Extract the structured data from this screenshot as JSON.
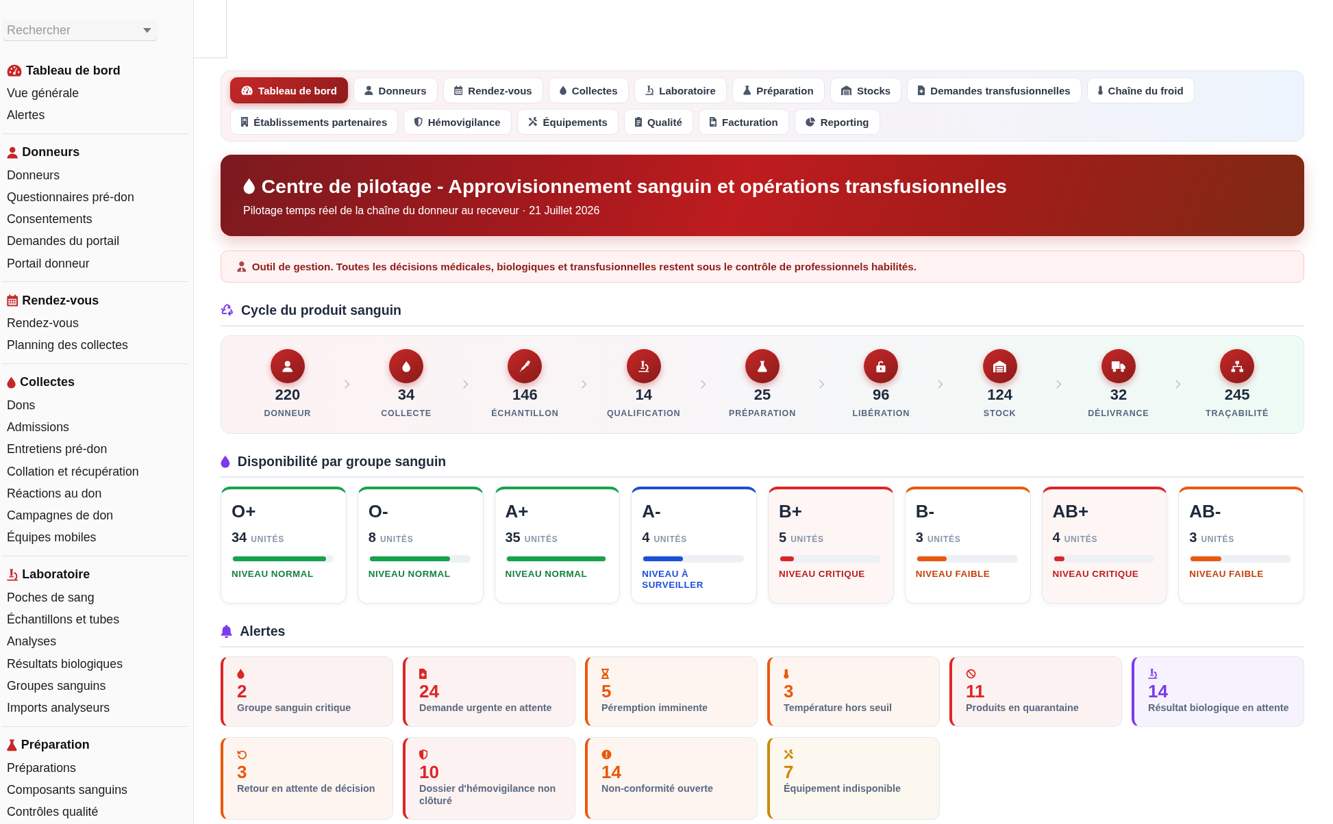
{
  "sidebar": {
    "search": {
      "placeholder": "Rechercher"
    },
    "sections": [
      {
        "title": "Tableau de bord",
        "items": [
          "Vue générale",
          "Alertes"
        ]
      },
      {
        "title": "Donneurs",
        "items": [
          "Donneurs",
          "Questionnaires pré-don",
          "Consentements",
          "Demandes du portail",
          "Portail donneur"
        ]
      },
      {
        "title": "Rendez-vous",
        "items": [
          "Rendez-vous",
          "Planning des collectes"
        ]
      },
      {
        "title": "Collectes",
        "items": [
          "Dons",
          "Admissions",
          "Entretiens pré-don",
          "Collation et récupération",
          "Réactions au don",
          "Campagnes de don",
          "Équipes mobiles"
        ]
      },
      {
        "title": "Laboratoire",
        "items": [
          "Poches de sang",
          "Échantillons et tubes",
          "Analyses",
          "Résultats biologiques",
          "Groupes sanguins",
          "Imports analyseurs"
        ]
      },
      {
        "title": "Préparation",
        "items": [
          "Préparations",
          "Composants sanguins",
          "Contrôles qualité"
        ]
      }
    ]
  },
  "nav_tabs": [
    {
      "label": "Tableau de bord",
      "selected": true
    },
    {
      "label": "Donneurs",
      "selected": false
    },
    {
      "label": "Rendez-vous",
      "selected": false
    },
    {
      "label": "Collectes",
      "selected": false
    },
    {
      "label": "Laboratoire",
      "selected": false
    },
    {
      "label": "Préparation",
      "selected": false
    },
    {
      "label": "Stocks",
      "selected": false
    },
    {
      "label": "Demandes transfusionnelles",
      "selected": false
    },
    {
      "label": "Chaîne du froid",
      "selected": false
    },
    {
      "label": "Établissements partenaires",
      "selected": false
    },
    {
      "label": "Hémovigilance",
      "selected": false
    },
    {
      "label": "Équipements",
      "selected": false
    },
    {
      "label": "Qualité",
      "selected": false
    },
    {
      "label": "Facturation",
      "selected": false
    },
    {
      "label": "Reporting",
      "selected": false
    }
  ],
  "banner": {
    "title": "Centre de pilotage - Approvisionnement sanguin et opérations transfusionnelles",
    "subtitle": "Pilotage temps réel de la chaîne du donneur au receveur · 21 Juillet 2026"
  },
  "notice": {
    "text": "Outil de gestion. Toutes les décisions médicales, biologiques et transfusionnelles restent sous le contrôle de professionnels habilités."
  },
  "cycle": {
    "title": "Cycle du produit sanguin",
    "steps": [
      {
        "value": "220",
        "label": "DONNEUR"
      },
      {
        "value": "34",
        "label": "COLLECTE"
      },
      {
        "value": "146",
        "label": "ÉCHANTILLON"
      },
      {
        "value": "14",
        "label": "QUALIFICATION"
      },
      {
        "value": "25",
        "label": "PRÉPARATION"
      },
      {
        "value": "96",
        "label": "LIBÉRATION"
      },
      {
        "value": "124",
        "label": "STOCK"
      },
      {
        "value": "32",
        "label": "DÉLIVRANCE"
      },
      {
        "value": "245",
        "label": "TRAÇABILITÉ"
      }
    ]
  },
  "blood_groups": {
    "title": "Disponibilité par groupe sanguin",
    "cards": [
      {
        "group": "O+",
        "units": "34",
        "unit_label": "UNITÉS",
        "level": 0.94,
        "status": "NIVEAU NORMAL",
        "kind": "normal"
      },
      {
        "group": "O-",
        "units": "8",
        "unit_label": "UNITÉS",
        "level": 0.81,
        "status": "NIVEAU NORMAL",
        "kind": "normal"
      },
      {
        "group": "A+",
        "units": "35",
        "unit_label": "UNITÉS",
        "level": 1,
        "status": "NIVEAU NORMAL",
        "kind": "normal"
      },
      {
        "group": "A-",
        "units": "4",
        "unit_label": "UNITÉS",
        "level": 0.4,
        "status": "NIVEAU À SURVEILLER",
        "kind": "watch"
      },
      {
        "group": "B+",
        "units": "5",
        "unit_label": "UNITÉS",
        "level": 0.14,
        "status": "NIVEAU CRITIQUE",
        "kind": "critical"
      },
      {
        "group": "B-",
        "units": "3",
        "unit_label": "UNITÉS",
        "level": 0.3,
        "status": "NIVEAU FAIBLE",
        "kind": "low"
      },
      {
        "group": "AB+",
        "units": "4",
        "unit_label": "UNITÉS",
        "level": 0.11,
        "status": "NIVEAU CRITIQUE",
        "kind": "critical"
      },
      {
        "group": "AB-",
        "units": "3",
        "unit_label": "UNITÉS",
        "level": 0.31,
        "status": "NIVEAU FAIBLE",
        "kind": "low"
      }
    ]
  },
  "alerts": {
    "title": "Alertes",
    "cards": [
      {
        "value": "2",
        "label": "Groupe sanguin critique",
        "color": "#dc2626"
      },
      {
        "value": "24",
        "label": "Demande urgente en attente",
        "color": "#dc2626"
      },
      {
        "value": "5",
        "label": "Péremption imminente",
        "color": "#ea580c"
      },
      {
        "value": "3",
        "label": "Température hors seuil",
        "color": "#ea580c"
      },
      {
        "value": "11",
        "label": "Produits en quarantaine",
        "color": "#dc2626"
      },
      {
        "value": "14",
        "label": "Résultat biologique en attente",
        "color": "#7c3aed"
      },
      {
        "value": "3",
        "label": "Retour en attente de décision",
        "color": "#ea580c"
      },
      {
        "value": "10",
        "label": "Dossier d'hémovigilance non clôturé",
        "color": "#dc2626"
      },
      {
        "value": "14",
        "label": "Non-conformité ouverte",
        "color": "#ea580c"
      },
      {
        "value": "7",
        "label": "Équipement indisponible",
        "color": "#ca8a04"
      }
    ]
  }
}
